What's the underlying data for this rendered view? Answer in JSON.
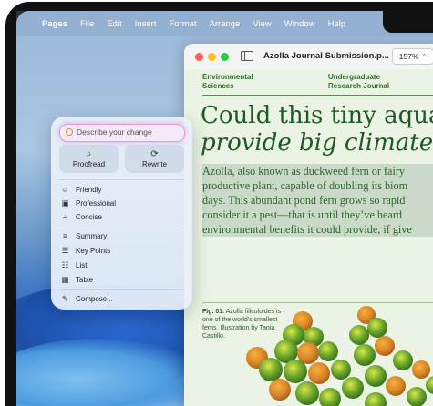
{
  "menubar": {
    "apple": "",
    "items": [
      "Pages",
      "File",
      "Edit",
      "Insert",
      "Format",
      "Arrange",
      "View",
      "Window",
      "Help"
    ]
  },
  "window": {
    "title": "Azolla Journal Submission.p...",
    "zoom": "157%"
  },
  "document": {
    "header_left": [
      "Environmental",
      "Sciences"
    ],
    "header_right": [
      "Undergraduate",
      "Research Journal"
    ],
    "headline": [
      "Could this tiny aqua",
      "provide big climate"
    ],
    "body_lines": [
      "Azolla, also known as duckweed fern or fairy",
      "productive plant, capable of doubling its biom",
      "days. This abundant pond fern grows so rapid",
      "consider it a pest—that is until they’ve heard",
      "environmental benefits it could provide, if give"
    ],
    "caption": {
      "label": "Fig. 01.",
      "text": "Azolla filiculoides is one of the world’s smallest ferns. Illustration by Tania Castillo."
    }
  },
  "writing_tools": {
    "placeholder": "Describe your change",
    "proofread": "Proofread",
    "rewrite": "Rewrite",
    "tone": [
      "Friendly",
      "Professional",
      "Concise"
    ],
    "format": [
      "Summary",
      "Key Points",
      "List",
      "Table"
    ],
    "compose": "Compose..."
  },
  "colors": {
    "accent_green": "#1f5a24",
    "glow": "#e59ad6"
  }
}
